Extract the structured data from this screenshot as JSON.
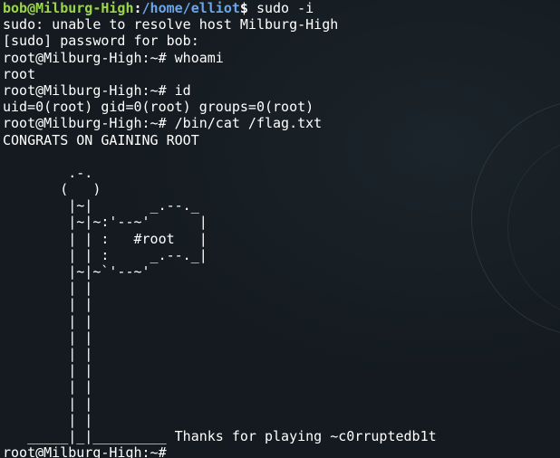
{
  "prompt": {
    "user_host": "bob@Milburg-High",
    "separator": ":",
    "path": "/home/elliot",
    "symbol": "$ ",
    "command": "sudo -i"
  },
  "lines": [
    "sudo: unable to resolve host Milburg-High",
    "[sudo] password for bob:",
    "root@Milburg-High:~# whoami",
    "root",
    "root@Milburg-High:~# id",
    "uid=0(root) gid=0(root) groups=0(root)",
    "root@Milburg-High:~# /bin/cat /flag.txt",
    "CONGRATS ON GAINING ROOT",
    "",
    "        .-.",
    "       (   )",
    "        |~|       _.--._",
    "        |~|~:'--~'      |",
    "        | | :   #root   |",
    "        | | :     _.--._|",
    "        |~|~`'--~'",
    "        | |",
    "        | |",
    "        | |",
    "        | |",
    "        | |",
    "        | |",
    "        | |",
    "        | |",
    "        | |",
    "   _____|_|_________ Thanks for playing ~c0rruptedb1t",
    "root@Milburg-High:~# "
  ]
}
